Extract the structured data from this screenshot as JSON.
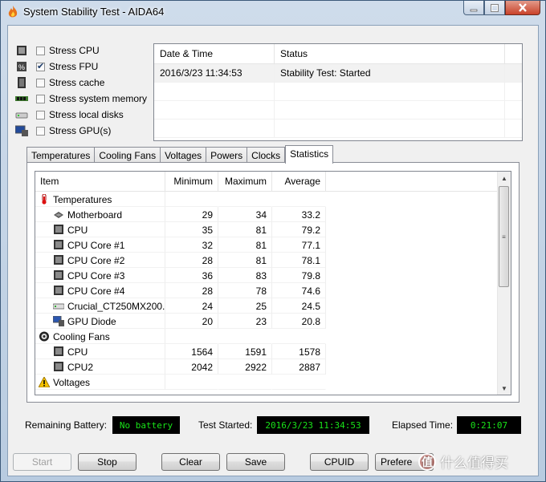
{
  "window": {
    "title": "System Stability Test - AIDA64"
  },
  "stress_options": [
    {
      "label": "Stress CPU",
      "checked": false,
      "icon": "cpu-chip-icon"
    },
    {
      "label": "Stress FPU",
      "checked": true,
      "icon": "fpu-icon"
    },
    {
      "label": "Stress cache",
      "checked": false,
      "icon": "cache-icon"
    },
    {
      "label": "Stress system memory",
      "checked": false,
      "icon": "memory-icon"
    },
    {
      "label": "Stress local disks",
      "checked": false,
      "icon": "disk-icon"
    },
    {
      "label": "Stress GPU(s)",
      "checked": false,
      "icon": "gpu-monitor-icon"
    }
  ],
  "log": {
    "headers": [
      "Date & Time",
      "Status"
    ],
    "rows": [
      {
        "datetime": "2016/3/23 11:34:53",
        "status": "Stability Test: Started"
      }
    ]
  },
  "tabs": [
    "Temperatures",
    "Cooling Fans",
    "Voltages",
    "Powers",
    "Clocks",
    "Statistics"
  ],
  "active_tab": "Statistics",
  "stats": {
    "headers": [
      "Item",
      "Minimum",
      "Maximum",
      "Average"
    ],
    "rows": [
      {
        "type": "group",
        "item": "Temperatures",
        "icon": "thermometer-icon",
        "min": "",
        "max": "",
        "avg": ""
      },
      {
        "type": "child",
        "item": "Motherboard",
        "icon": "motherboard-icon",
        "min": "29",
        "max": "34",
        "avg": "33.2"
      },
      {
        "type": "child",
        "item": "CPU",
        "icon": "cpu-icon",
        "min": "35",
        "max": "81",
        "avg": "79.2"
      },
      {
        "type": "child",
        "item": "CPU Core #1",
        "icon": "cpu-icon",
        "min": "32",
        "max": "81",
        "avg": "77.1"
      },
      {
        "type": "child",
        "item": "CPU Core #2",
        "icon": "cpu-icon",
        "min": "28",
        "max": "81",
        "avg": "78.1"
      },
      {
        "type": "child",
        "item": "CPU Core #3",
        "icon": "cpu-icon",
        "min": "36",
        "max": "83",
        "avg": "79.8"
      },
      {
        "type": "child",
        "item": "CPU Core #4",
        "icon": "cpu-icon",
        "min": "28",
        "max": "78",
        "avg": "74.6"
      },
      {
        "type": "child",
        "item": "Crucial_CT250MX200...",
        "icon": "disk-icon",
        "min": "24",
        "max": "25",
        "avg": "24.5"
      },
      {
        "type": "child",
        "item": "GPU Diode",
        "icon": "gpu-icon",
        "min": "20",
        "max": "23",
        "avg": "20.8"
      },
      {
        "type": "group",
        "item": "Cooling Fans",
        "icon": "fan-icon",
        "min": "",
        "max": "",
        "avg": ""
      },
      {
        "type": "child",
        "item": "CPU",
        "icon": "cpu-icon",
        "min": "1564",
        "max": "1591",
        "avg": "1578"
      },
      {
        "type": "child",
        "item": "CPU2",
        "icon": "cpu-icon",
        "min": "2042",
        "max": "2922",
        "avg": "2887"
      },
      {
        "type": "group",
        "item": "Voltages",
        "icon": "warning-icon",
        "min": "",
        "max": "",
        "avg": ""
      }
    ]
  },
  "status_bar": {
    "battery_label": "Remaining Battery:",
    "battery_value": "No battery",
    "started_label": "Test Started:",
    "started_value": "2016/3/23 11:34:53",
    "elapsed_label": "Elapsed Time:",
    "elapsed_value": "0:21:07"
  },
  "buttons": {
    "start": "Start",
    "stop": "Stop",
    "clear": "Clear",
    "save": "Save",
    "cpuid": "CPUID",
    "preferences": "Prefere"
  },
  "watermark": {
    "logo": "值",
    "text": "什么值得买"
  },
  "colors": {
    "lcd_text": "#19e319",
    "lcd_bg": "#000000",
    "close_button": "#c9422a"
  }
}
